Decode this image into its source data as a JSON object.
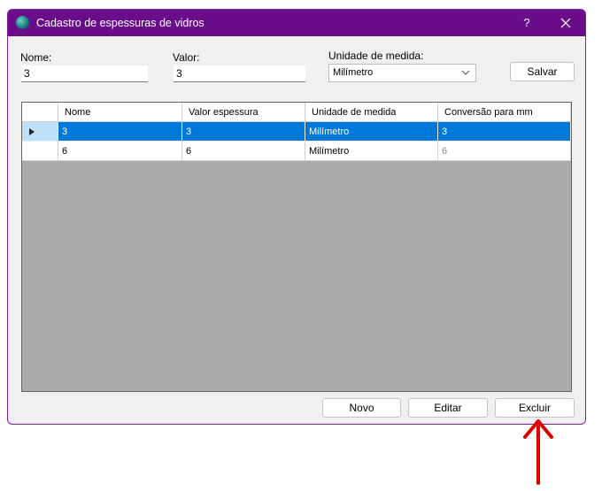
{
  "window": {
    "title": "Cadastro de espessuras de vidros",
    "help_label": "?"
  },
  "form": {
    "nome_label": "Nome:",
    "nome_value": "3",
    "valor_label": "Valor:",
    "valor_value": "3",
    "unidade_label": "Unidade de medida:",
    "unidade_value": "Milímetro",
    "save_label": "Salvar"
  },
  "table": {
    "columns": [
      "Nome",
      "Valor espessura",
      "Unidade de medida",
      "Conversão para mm"
    ],
    "rows": [
      [
        "3",
        "3",
        "Milímetro",
        "3"
      ],
      [
        "6",
        "6",
        "Milímetro",
        "6"
      ]
    ]
  },
  "footer": {
    "new_label": "Novo",
    "edit_label": "Editar",
    "delete_label": "Excluir"
  },
  "colors": {
    "titlebar": "#6a0d8a",
    "selection": "#0078d7",
    "grid_background": "#ababab",
    "annotation_arrow": "#e00000"
  }
}
